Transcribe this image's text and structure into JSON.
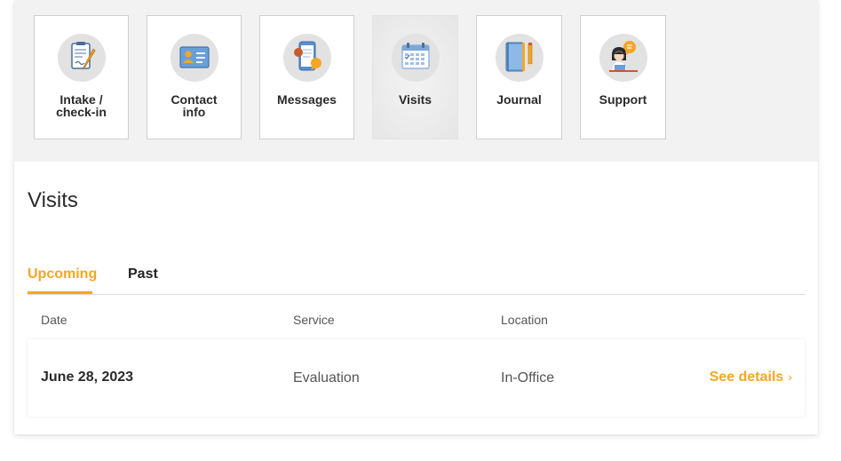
{
  "tiles": [
    {
      "label": "Intake /\ncheck-in",
      "icon": "clipboard-pen-icon",
      "active": false
    },
    {
      "label": "Contact\ninfo",
      "icon": "id-card-icon",
      "active": false
    },
    {
      "label": "Messages",
      "icon": "phone-chat-icon",
      "active": false
    },
    {
      "label": "Visits",
      "icon": "calendar-icon",
      "active": true
    },
    {
      "label": "Journal",
      "icon": "notebook-icon",
      "active": false
    },
    {
      "label": "Support",
      "icon": "support-agent-icon",
      "active": false
    }
  ],
  "page": {
    "title": "Visits"
  },
  "tabs": {
    "upcoming": "Upcoming",
    "past": "Past"
  },
  "table": {
    "headers": {
      "date": "Date",
      "service": "Service",
      "location": "Location"
    },
    "rows": [
      {
        "date": "June 28, 2023",
        "service": "Evaluation",
        "location": "In-Office",
        "action": "See details"
      }
    ]
  },
  "colors": {
    "accent": "#f5a623",
    "band": "#f2f2f2",
    "icon_circle": "#e2e2e2"
  }
}
